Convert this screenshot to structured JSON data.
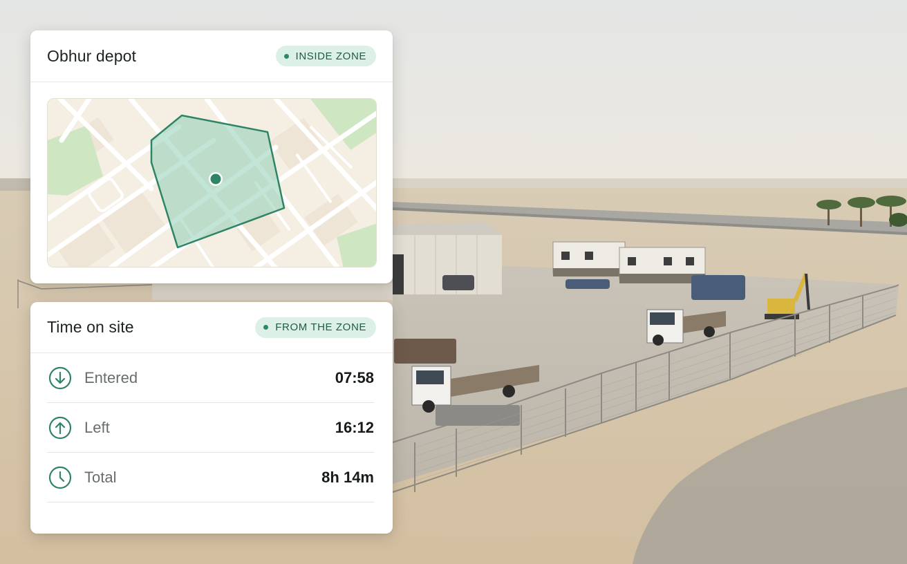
{
  "zone_card": {
    "title": "Obhur depot",
    "status_badge": "INSIDE ZONE"
  },
  "time_card": {
    "title": "Time on site",
    "source_badge": "FROM THE ZONE",
    "rows": [
      {
        "label": "Entered",
        "value": "07:58",
        "icon": "arrow-down-circle-icon"
      },
      {
        "label": "Left",
        "value": "16:12",
        "icon": "arrow-up-circle-icon"
      },
      {
        "label": "Total",
        "value": "8h 14m",
        "icon": "clock-icon"
      }
    ]
  },
  "colors": {
    "accent": "#2a8a67",
    "badge_bg": "#dcf0e7",
    "geofence_fill": "#8fd0b6",
    "geofence_stroke": "#2e8466"
  }
}
